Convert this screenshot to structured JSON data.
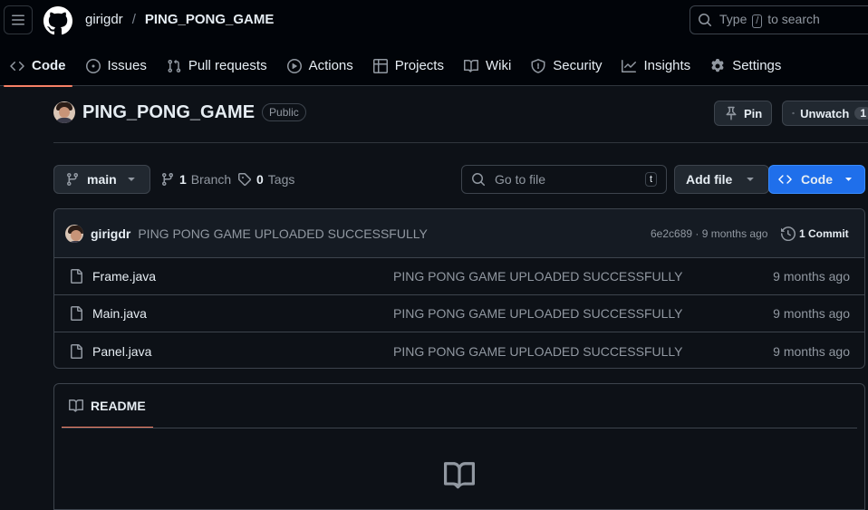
{
  "header": {
    "owner": "girigdr",
    "separator": "/",
    "repo": "PING_PONG_GAME",
    "search_prefix": "Type",
    "search_key": "/",
    "search_suffix": "to search"
  },
  "tabs": [
    {
      "label": "Code",
      "icon": "code-icon",
      "active": true
    },
    {
      "label": "Issues",
      "icon": "issue-icon"
    },
    {
      "label": "Pull requests",
      "icon": "pull-request-icon"
    },
    {
      "label": "Actions",
      "icon": "play-icon"
    },
    {
      "label": "Projects",
      "icon": "table-icon"
    },
    {
      "label": "Wiki",
      "icon": "book-icon"
    },
    {
      "label": "Security",
      "icon": "shield-icon"
    },
    {
      "label": "Insights",
      "icon": "graph-icon"
    },
    {
      "label": "Settings",
      "icon": "gear-icon"
    }
  ],
  "repo_header": {
    "title": "PING_PONG_GAME",
    "visibility": "Public",
    "pin_label": "Pin",
    "unwatch_label": "Unwatch",
    "unwatch_count": "1"
  },
  "toolbar": {
    "branch": "main",
    "branch_count": "1",
    "branch_label": "Branch",
    "tag_count": "0",
    "tag_label": "Tags",
    "goto_placeholder": "Go to file",
    "goto_key": "t",
    "add_file": "Add file",
    "code": "Code"
  },
  "latest_commit": {
    "author": "girigdr",
    "message": "PING PONG GAME UPLOADED SUCCESSFULLY",
    "hash_time": "6e2c689 · 9 months ago",
    "commits": "1 Commit"
  },
  "files": [
    {
      "name": "Frame.java",
      "message": "PING PONG GAME UPLOADED SUCCESSFULLY",
      "date": "9 months ago"
    },
    {
      "name": "Main.java",
      "message": "PING PONG GAME UPLOADED SUCCESSFULLY",
      "date": "9 months ago"
    },
    {
      "name": "Panel.java",
      "message": "PING PONG GAME UPLOADED SUCCESSFULLY",
      "date": "9 months ago"
    }
  ],
  "readme": {
    "tab_label": "README"
  },
  "colors": {
    "background": "#0d1117",
    "header": "#010409",
    "accent_underline": "#f78166",
    "primary_button": "#1f6feb"
  }
}
